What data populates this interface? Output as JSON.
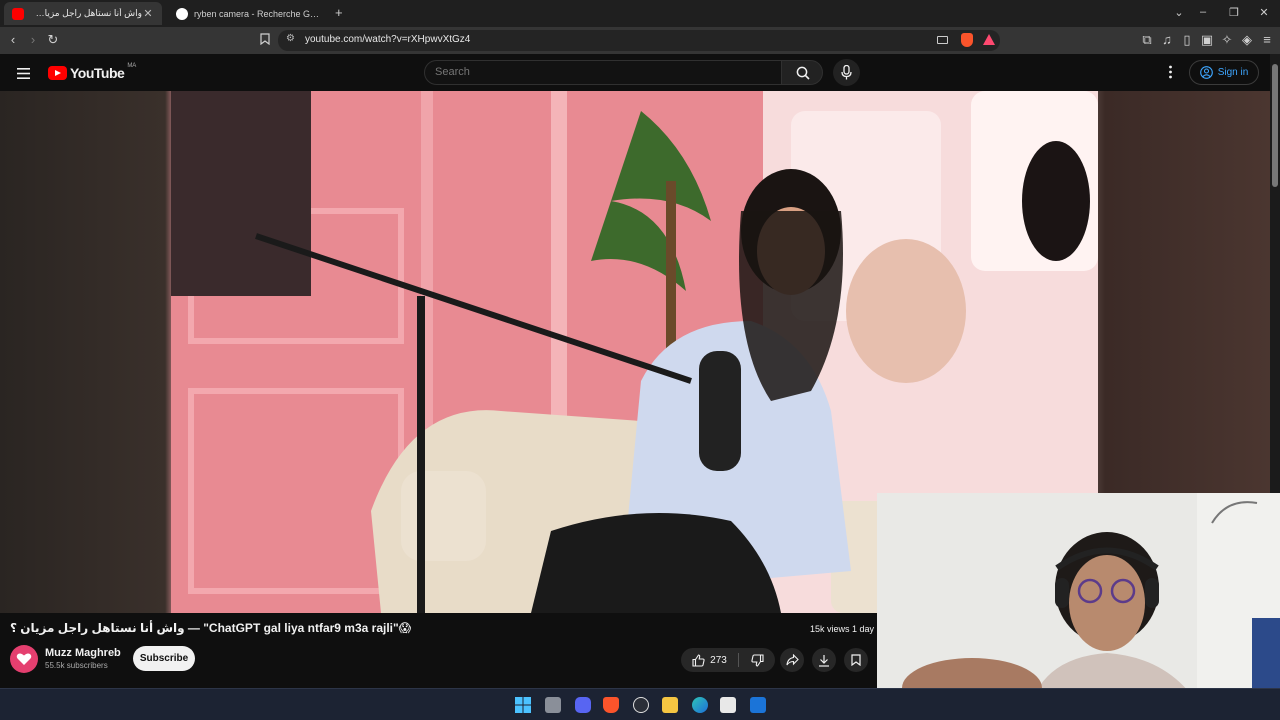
{
  "browser": {
    "tabs": [
      {
        "title": "واش أنا نستاهل راجل مزيان ؟ — \"",
        "active": true
      },
      {
        "title": "ryben camera - Recherche Google",
        "active": false
      }
    ],
    "new_tab": "+",
    "url": "youtube.com/watch?v=rXHpwvXtGz4",
    "accent": "#ff0000"
  },
  "youtube": {
    "logo_text": "YouTube",
    "country_code": "MA",
    "search_placeholder": "Search",
    "signin_label": "Sign in"
  },
  "video": {
    "title": "واش أنا نستاهل راجل مزيان ؟ — \"ChatGPT gal liya ntfar9 m3a rajli\"😱",
    "views": "15k views  1 day",
    "channel_name": "Muzz Maghreb",
    "subscribers": "55.5k subscribers",
    "subscribe_label": "Subscribe",
    "likes": "273"
  },
  "taskbar": {
    "icons": [
      "windows-start-icon",
      "task-view-icon",
      "discord-icon",
      "brave-icon",
      "chatgpt-icon",
      "file-explorer-icon",
      "edge-icon",
      "microsoft-store-icon",
      "outlook-icon"
    ]
  }
}
